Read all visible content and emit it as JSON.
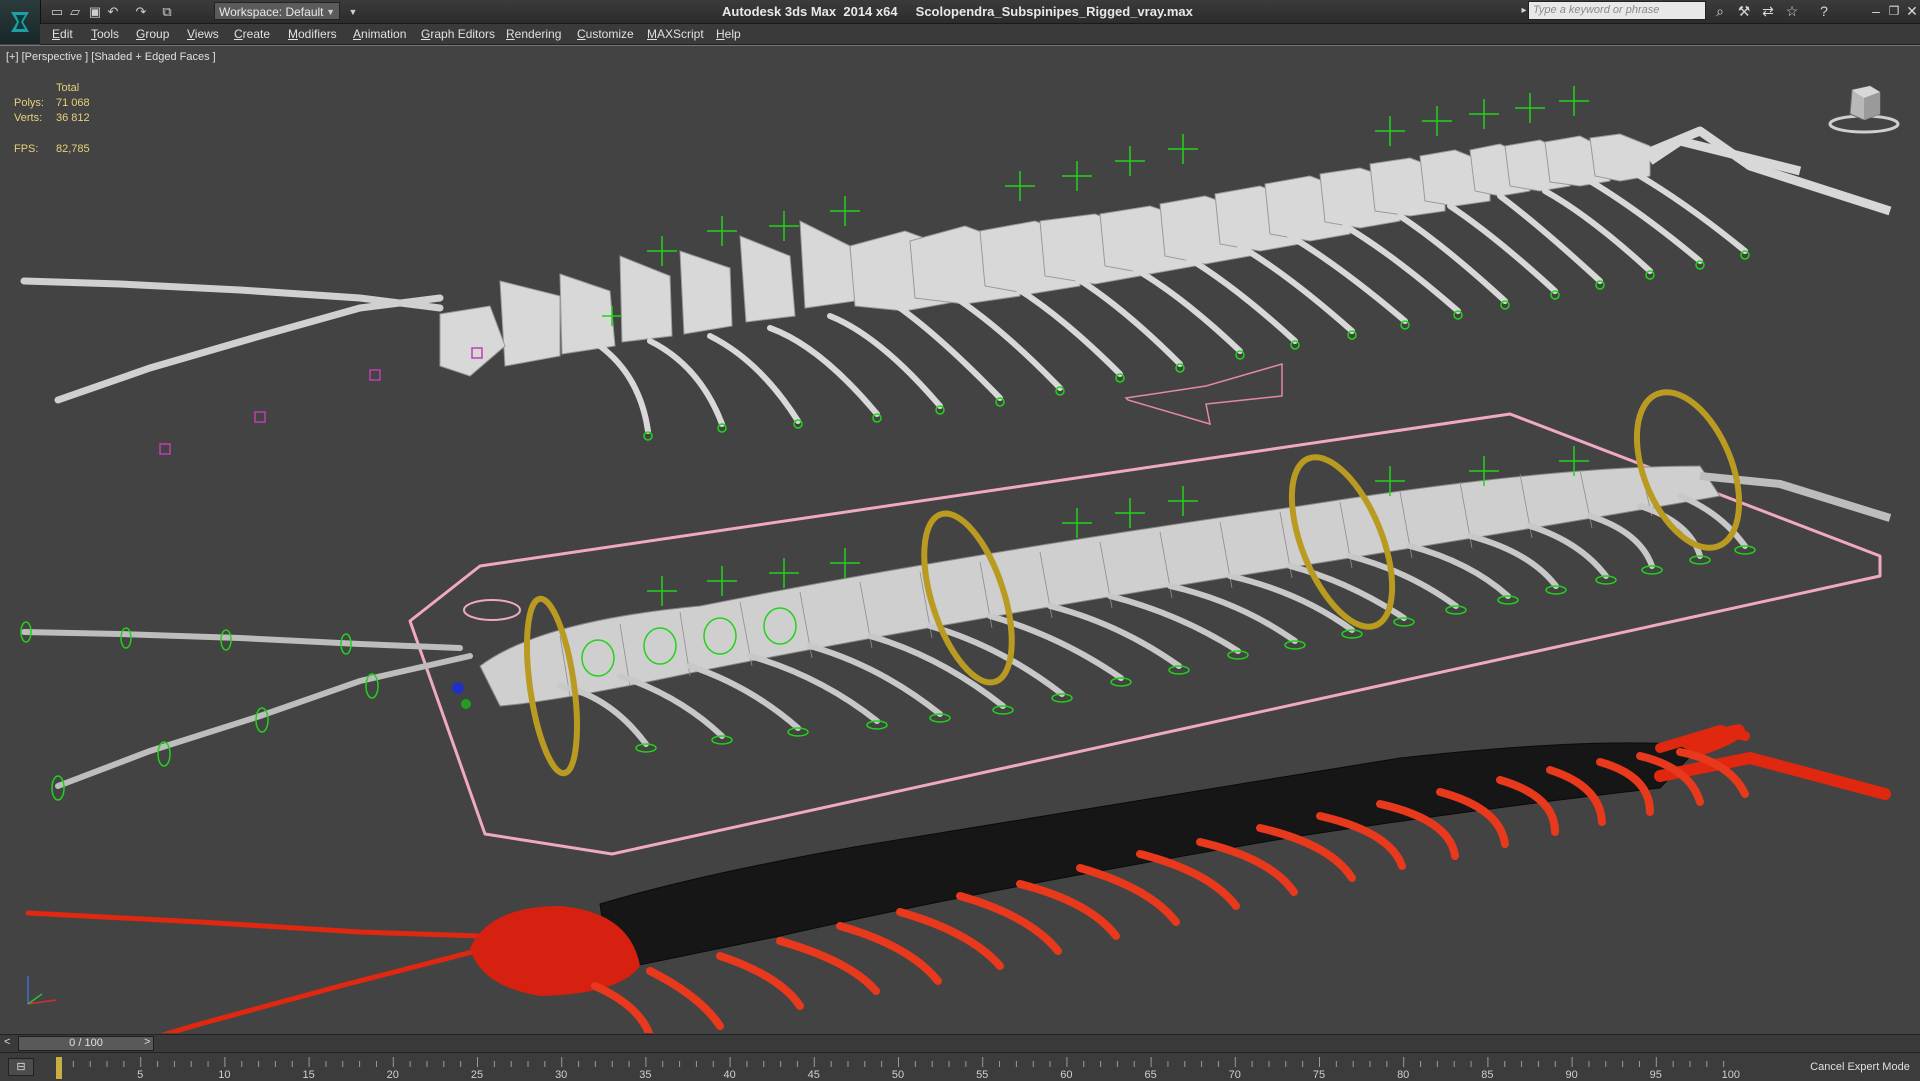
{
  "titlebar": {
    "app_title": "Autodesk 3ds Max  2014 x64",
    "file_name": "Scolopendra_Subspinipes_Rigged_vray.max",
    "workspace": "Workspace: Default",
    "search_placeholder": "Type a keyword or phrase",
    "quick_access_icons": [
      "new-file-icon",
      "open-file-icon",
      "save-file-icon",
      "undo-icon",
      "redo-icon",
      "project-folder-icon"
    ],
    "right_icons": [
      "binoculars-icon",
      "wrench-icon",
      "exchange-icon",
      "star-icon",
      "help-icon"
    ]
  },
  "menu": {
    "items": [
      "Edit",
      "Tools",
      "Group",
      "Views",
      "Create",
      "Modifiers",
      "Animation",
      "Graph Editors",
      "Rendering",
      "Customize",
      "MAXScript",
      "Help"
    ]
  },
  "viewport": {
    "label": "[+] [Perspective ] [Shaded + Edged Faces ]",
    "stats": {
      "header": "Total",
      "polys_label": "Polys:",
      "polys_value": "71 068",
      "verts_label": "Verts:",
      "verts_value": "36 812",
      "fps_label": "FPS:",
      "fps_value": "82,785"
    },
    "colors": {
      "background": "#434343",
      "bones": "#d6d6d6",
      "helpers": "#22d21c",
      "mesh_wire": "#bfbfbf",
      "rings": "#b99b22",
      "selection_outline": "#f0a9c4",
      "arrow": "#e58aa0",
      "render_red": "#e0270f",
      "render_black": "#151515"
    }
  },
  "timeline": {
    "frame_label": "0 / 100",
    "prev": "<",
    "next": ">",
    "ticks": [
      "5",
      "10",
      "15",
      "20",
      "25",
      "30",
      "35",
      "40",
      "45",
      "50",
      "55",
      "60",
      "65",
      "70",
      "75",
      "80",
      "85",
      "90",
      "95",
      "100"
    ],
    "current_frame_marker": "0"
  },
  "statusbar": {
    "cancel_expert_mode": "Cancel Expert Mode"
  }
}
